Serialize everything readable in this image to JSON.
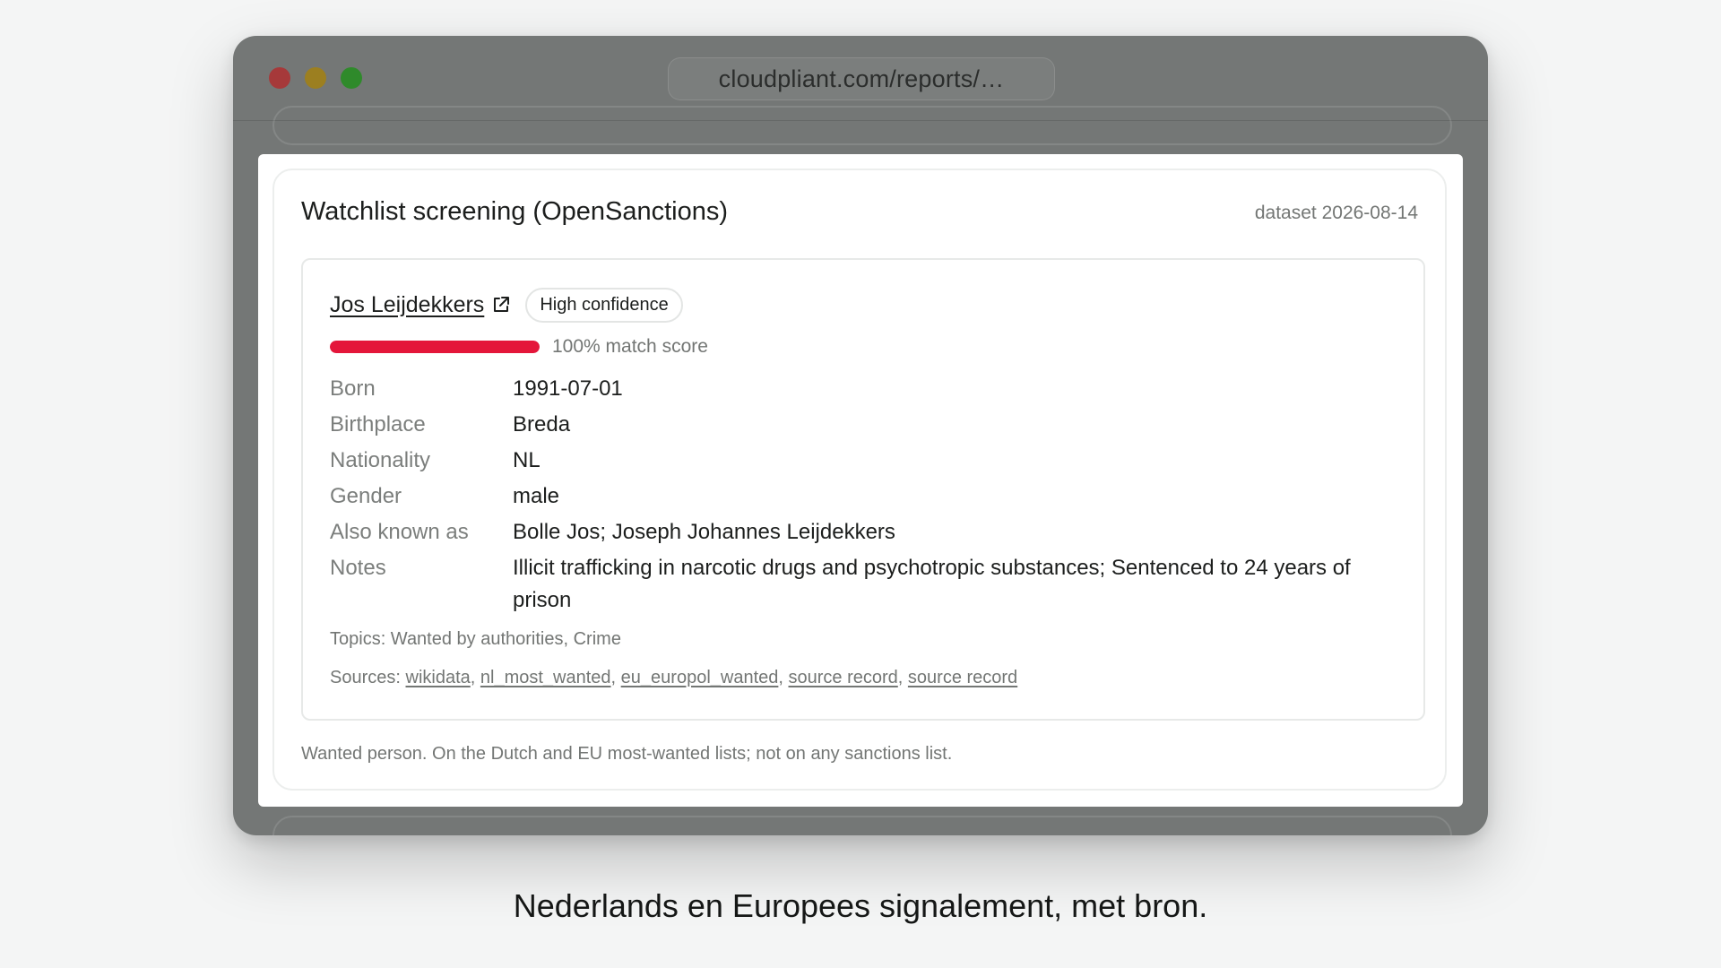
{
  "browser": {
    "url": "cloudpliant.com/reports/…",
    "colors": {
      "close": "#a6393a",
      "minimize": "#9c7f20",
      "maximize": "#2f8a2b"
    }
  },
  "card": {
    "title": "Watchlist screening (OpenSanctions)",
    "dataset": "dataset 2026-08-14",
    "footnote": "Wanted person. On the Dutch and EU most-wanted lists; not on any sanctions list."
  },
  "match": {
    "name": "Jos Leijdekkers",
    "external_link_icon": "external-link-icon",
    "confidence": "High confidence",
    "score_fraction": 1.0,
    "score_color": "#e4163a",
    "score_text": "100% match score",
    "fields": [
      {
        "label": "Born",
        "value": "1991-07-01"
      },
      {
        "label": "Birthplace",
        "value": "Breda"
      },
      {
        "label": "Nationality",
        "value": "NL"
      },
      {
        "label": "Gender",
        "value": "male"
      },
      {
        "label": "Also known as",
        "value": "Bolle Jos; Joseph Johannes Leijdekkers"
      },
      {
        "label": "Notes",
        "value": "Illicit trafficking in narcotic drugs and psychotropic substances; Sentenced to 24 years of prison"
      }
    ],
    "topics": "Topics: Wanted by authorities, Crime",
    "sources_label": "Sources:",
    "sources": [
      "wikidata",
      "nl_most_wanted",
      "eu_europol_wanted",
      "source record",
      "source record"
    ]
  },
  "caption": "Nederlands en Europees signalement, met bron."
}
